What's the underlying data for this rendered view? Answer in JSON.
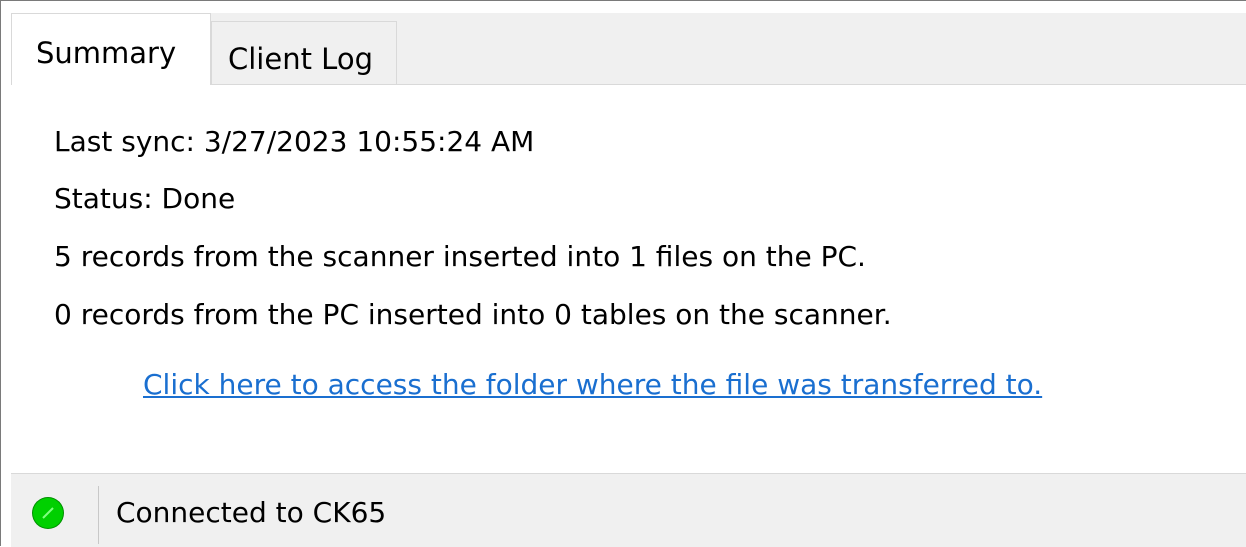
{
  "tabs": [
    {
      "label": "Summary",
      "active": true
    },
    {
      "label": "Client Log",
      "active": false
    }
  ],
  "summary": {
    "last_sync": "Last sync: 3/27/2023 10:55:24 AM",
    "status": "Status: Done",
    "scanner_to_pc": "5 records from the scanner inserted into 1 files on the PC.",
    "pc_to_scanner": "0 records from the PC inserted into 0 tables on the scanner.",
    "folder_link": "Click here to access the folder where the file was transferred to."
  },
  "statusbar": {
    "connection_icon": "green-status-dot-icon",
    "connection_color": "#00d000",
    "text": "Connected to CK65"
  },
  "colors": {
    "link": "#1a6fd0",
    "chrome": "#f0f0f0"
  }
}
